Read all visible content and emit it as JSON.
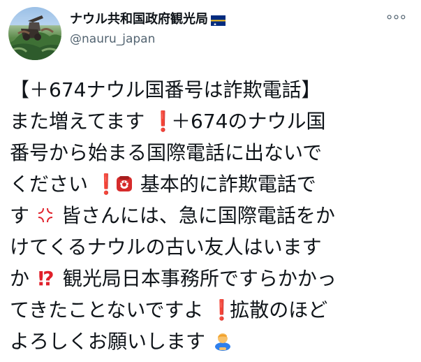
{
  "account": {
    "display_name": "ナウル共和国政府観光局",
    "handle": "@nauru_japan",
    "more_label": "°°°",
    "flag_icon": "nauru-flag-icon",
    "avatar_icon": "profile-avatar-icon"
  },
  "tweet": {
    "lines": {
      "l1": "【＋674ナウル国番号は詐欺電話】",
      "l2a": "また増えてます",
      "l2b": "＋674のナウル国",
      "l3": "番号から始まる国際電話に出ないで",
      "l4a": "ください",
      "l4b": "基本的に詐欺電話で",
      "l5a": "す",
      "l5b": "皆さんには、急に国際電話をか",
      "l6": "けてくるナウルの古い友人はいます",
      "l7a": "か",
      "l7b": "観光局日本事務所ですらかかっ",
      "l8a": "てきたことないですよ",
      "l8b": "拡散のほど",
      "l9": "よろしくお願いします"
    },
    "emoji": {
      "exclaim": "❗",
      "question_exclaim": "⁉",
      "phone_icon": "telephone-icon",
      "anger_icon": "anger-symbol-icon",
      "bow_icon": "bowing-person-icon"
    }
  },
  "colors": {
    "text": "#0f1419",
    "secondary_text": "#536471",
    "emoji_red": "#e0202a",
    "phone_red": "#d62b2b",
    "flag_blue": "#002b7f",
    "flag_yellow": "#ffc61e"
  }
}
